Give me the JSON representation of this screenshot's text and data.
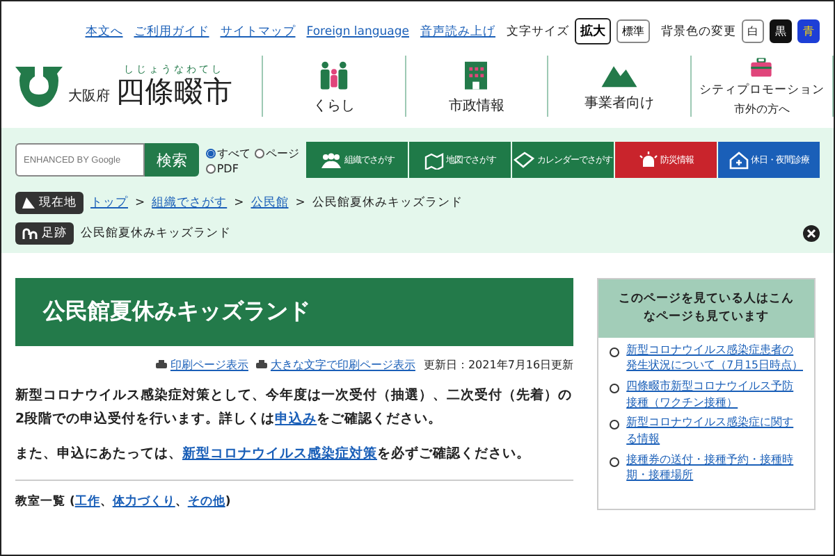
{
  "utility_links": [
    "本文へ",
    "ご利用ガイド",
    "サイトマップ",
    "Foreign language",
    "音声読み上げ"
  ],
  "text_size": {
    "label": "文字サイズ",
    "options": [
      {
        "label": "拡大",
        "selected": true
      },
      {
        "label": "標準",
        "selected": false
      }
    ]
  },
  "background_color": {
    "label": "背景色の変更",
    "options": [
      {
        "label": "白",
        "kind": "white"
      },
      {
        "label": "黒",
        "kind": "black"
      },
      {
        "label": "青",
        "kind": "blue"
      }
    ]
  },
  "logo": {
    "prefecture": "大阪府",
    "reading": "しじょうなわてし",
    "city": "四條畷市"
  },
  "main_nav": [
    {
      "label": "くらし",
      "kind": "people"
    },
    {
      "label": "市政情報",
      "kind": "building"
    },
    {
      "label": "事業者向け",
      "kind": "mountain"
    },
    {
      "label": "シティプロモーション",
      "sublabel": "市外の方へ",
      "kind": "briefcase"
    }
  ],
  "search": {
    "placeholder": "ENHANCED BY Google",
    "button": "検索",
    "scopes": [
      {
        "label": "すべて",
        "selected": true
      },
      {
        "label": "ページ",
        "selected": false
      },
      {
        "label": "PDF",
        "selected": false
      }
    ]
  },
  "quick_links": [
    {
      "label": "組織でさがす",
      "kind": "people",
      "color": "#1f7a48"
    },
    {
      "label": "地図でさがす",
      "kind": "map",
      "color": "#1f7a48"
    },
    {
      "label": "カレンダーでさがす",
      "kind": "calendar",
      "color": "#1f7a48"
    },
    {
      "label": "防災情報",
      "kind": "siren",
      "color": "#c9242c"
    },
    {
      "label": "休日・夜間診療",
      "kind": "house",
      "color": "#1a5fb8"
    }
  ],
  "breadcrumb": {
    "label": "現在地",
    "separator": ">",
    "items": [
      {
        "text": "トップ",
        "link": true
      },
      {
        "text": "組織でさがす",
        "link": true
      },
      {
        "text": "公民館",
        "link": true
      },
      {
        "text": "公民館夏休みキッズランド",
        "link": false
      }
    ]
  },
  "footprints": {
    "label": "足跡",
    "items": [
      "公民館夏休みキッズランド"
    ]
  },
  "page_title": "公民館夏休みキッズランド",
  "print_links": [
    "印刷ページ表示",
    "大きな文字で印刷ページ表示"
  ],
  "updated": "更新日：2021年7月16日更新",
  "paragraphs": [
    [
      {
        "kind": "text",
        "text": "新型コロナウイルス感染症対策として、今年度は一次受付（抽選）、二次受付（先着）の2段階での申込受付を行います。詳しくは"
      },
      {
        "kind": "link",
        "text": "申込み"
      },
      {
        "kind": "text",
        "text": "をご確認ください。"
      }
    ],
    [
      {
        "kind": "text",
        "text": "また、申込にあたっては、"
      },
      {
        "kind": "link",
        "text": "新型コロナウイルス感染症対策"
      },
      {
        "kind": "text",
        "text": "を必ずご確認ください。"
      }
    ]
  ],
  "class_list": [
    {
      "kind": "text",
      "text": "教室一覧 ("
    },
    {
      "kind": "link",
      "text": "工作"
    },
    {
      "kind": "text",
      "text": "、"
    },
    {
      "kind": "link",
      "text": "体力づくり"
    },
    {
      "kind": "text",
      "text": "、"
    },
    {
      "kind": "link",
      "text": "その他"
    },
    {
      "kind": "text",
      "text": ")"
    }
  ],
  "sidebar": {
    "title": "このページを見ている人はこんなページも見ています",
    "items": [
      "新型コロナウイルス感染症患者の発生状況について（7月15日時点）",
      "四條畷市新型コロナウイルス予防接種（ワクチン接種）",
      "新型コロナウイルス感染症に関する情報",
      "接種券の送付・接種予約・接種時期・接種場所"
    ]
  }
}
